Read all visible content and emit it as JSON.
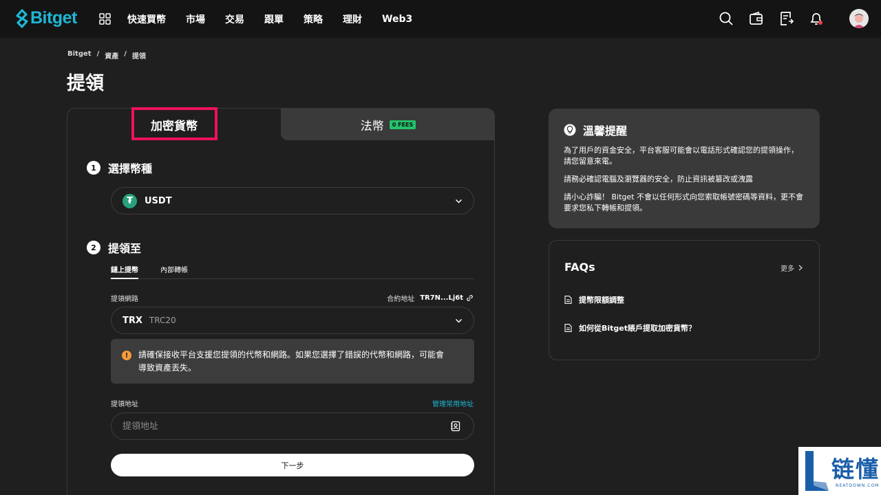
{
  "nav": {
    "logo": "Bitget",
    "items": [
      "快速買幣",
      "市場",
      "交易",
      "跟單",
      "策略",
      "理財",
      "Web3"
    ]
  },
  "breadcrumb": [
    "Bitget",
    "/",
    "資產",
    "/",
    "提領"
  ],
  "page_title": "提領",
  "tabs": {
    "crypto": "加密貨幣",
    "fiat": "法幣",
    "fees_badge": "0 FEES"
  },
  "step1": {
    "num": "1",
    "label": "選擇幣種",
    "coin_symbol": "₮",
    "coin": "USDT"
  },
  "step2": {
    "num": "2",
    "label": "提領至",
    "subtabs": [
      "鏈上提幣",
      "內部轉帳"
    ],
    "network_label": "提領網路",
    "contract_label": "合約地址",
    "contract_address": "TR7N...Lj6t",
    "network_main": "TRX",
    "network_sub": "TRC20",
    "warning_icon": "!",
    "warning_line1": "請確保接收平台支援您提領的代幣和網路。如果您選擇了錯誤的代幣和網路，可能會",
    "warning_line2": "導致資產丟失。",
    "address_label": "提領地址",
    "manage_link": "管理常用地址",
    "address_placeholder": "提領地址",
    "next_button": "下一步"
  },
  "reminder": {
    "title": "溫馨提醒",
    "p1": "為了用戶的資金安全，平台客服可能會以電話形式確認您的提領操作，請您留意來電。",
    "p2": "請務必確認電腦及瀏覽器的安全，防止資訊被篡改或洩露",
    "p3": "請小心詐騙！ Bitget 不會以任何形式向您索取帳號密碼等資料，更不會要求您私下轉帳和提領。"
  },
  "faq": {
    "title": "FAQs",
    "more": "更多",
    "items": [
      "提幣限額調整",
      "如何從Bitget賬戶提取加密貨幣？"
    ]
  },
  "watermark": {
    "text": "链懂",
    "sub": "NEATDOWN.COM"
  },
  "colors": {
    "brand": "#1eb7d6",
    "highlight": "#f0115e",
    "fees_green": "#23c26a",
    "warning": "#f59a3c"
  }
}
